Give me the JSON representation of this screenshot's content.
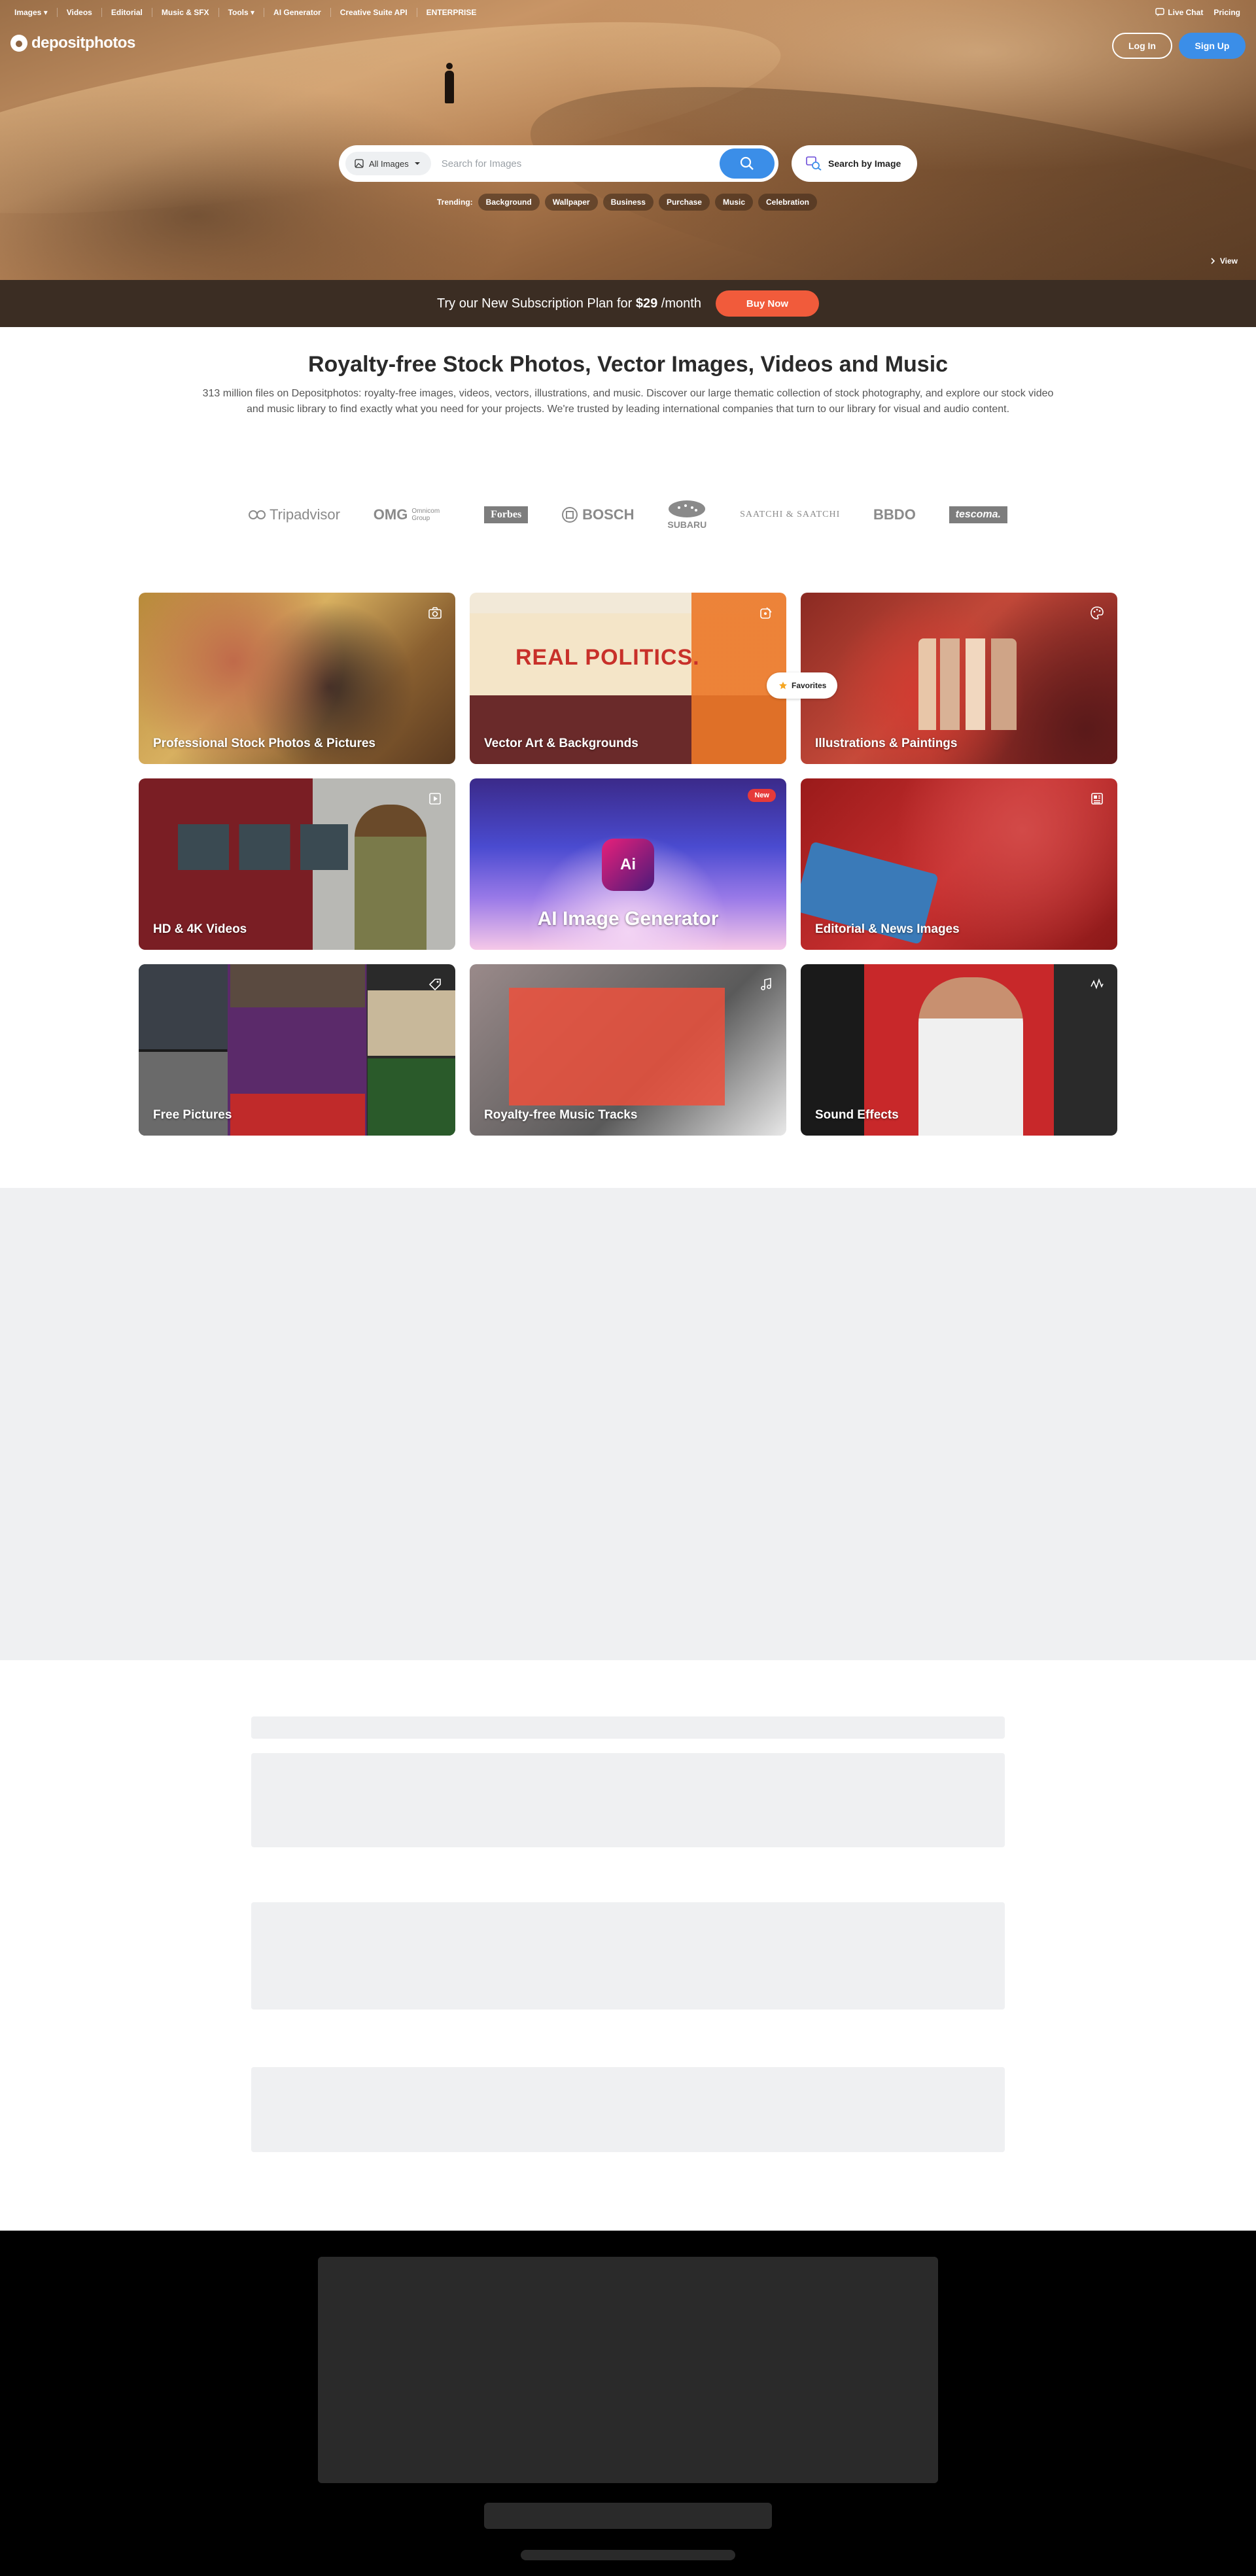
{
  "nav": {
    "items": [
      "Images ▾",
      "Videos",
      "Editorial",
      "Music & SFX",
      "Tools ▾",
      "AI Generator",
      "Creative Suite API",
      "ENTERPRISE"
    ],
    "live_chat": "Live Chat",
    "pricing": "Pricing"
  },
  "logo": {
    "text": "depositphotos"
  },
  "auth": {
    "login": "Log In",
    "signup": "Sign Up"
  },
  "search": {
    "category": "All Images",
    "placeholder": "Search for Images",
    "search_by_image": "Search by Image"
  },
  "trending": {
    "label": "Trending:",
    "chips": [
      "Background",
      "Wallpaper",
      "Business",
      "Purchase",
      "Music",
      "Celebration"
    ]
  },
  "hero": {
    "view_label": "View"
  },
  "promo": {
    "text_before": "Try our New Subscription Plan for",
    "price": "$29",
    "text_after": "/month",
    "button": "Buy Now"
  },
  "intro": {
    "title": "Royalty-free Stock Photos, Vector Images, Videos and Music",
    "description": "313 million files on Depositphotos: royalty-free images, videos, vectors, illustrations, and music. Discover our large thematic collection of stock photography, and explore our stock video and music library to find exactly what you need for your projects. We're trusted by leading international companies that turn to our library for visual and audio content."
  },
  "brands": [
    "Tripadvisor",
    "OMG",
    "Omnicom Group",
    "Forbes",
    "BOSCH",
    "SUBARU",
    "SAATCHI & SAATCHI",
    "BBDO",
    "tescoma."
  ],
  "categories": [
    {
      "label": "Professional Stock Photos & Pictures",
      "icon": "camera-icon"
    },
    {
      "label": "Vector Art & Backgrounds",
      "icon": "pen-tool-icon",
      "art_text": "REAL POLITICS."
    },
    {
      "label": "Illustrations & Paintings",
      "icon": "palette-icon"
    },
    {
      "label": "HD & 4K Videos",
      "icon": "play-icon"
    },
    {
      "label": "AI Image Generator",
      "badge": "New",
      "art_text": "Ai"
    },
    {
      "label": "Editorial & News Images",
      "icon": "newspaper-icon"
    },
    {
      "label": "Free Pictures",
      "icon": "tag-icon"
    },
    {
      "label": "Royalty-free Music Tracks",
      "icon": "music-note-icon"
    },
    {
      "label": "Sound Effects",
      "icon": "waveform-icon"
    }
  ],
  "favorites": {
    "label": "Favorites"
  },
  "colors": {
    "accent_blue": "#3b8ee8",
    "buy_orange": "#f15b3b",
    "promo_bg": "#3b2d23",
    "new_badge": "#e63a3a"
  }
}
